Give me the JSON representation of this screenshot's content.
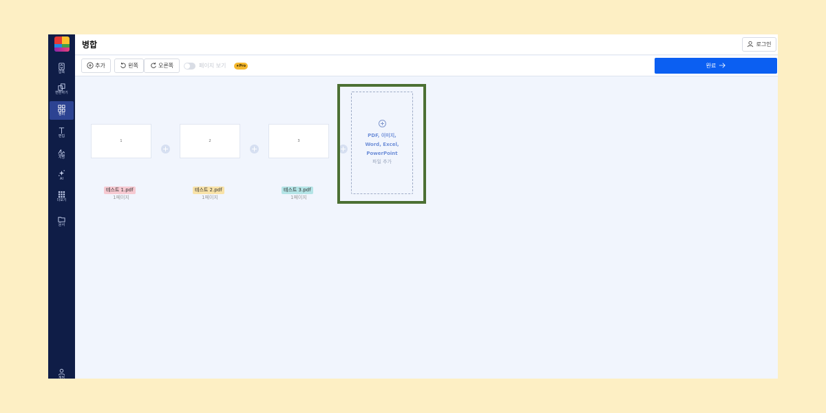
{
  "app": {
    "title": "병합"
  },
  "header": {
    "login_label": "로그인"
  },
  "sidebar": {
    "items": [
      {
        "label": "압축",
        "icon": "compress-icon",
        "active": false
      },
      {
        "label": "변환하기",
        "icon": "convert-icon",
        "active": false
      },
      {
        "label": "정리",
        "icon": "organize-icon",
        "active": true
      },
      {
        "label": "편집",
        "icon": "text-edit-icon",
        "active": false
      },
      {
        "label": "서명",
        "icon": "signature-icon",
        "active": false
      },
      {
        "label": "AI",
        "icon": "sparkle-icon",
        "active": false
      },
      {
        "label": "더보기",
        "icon": "grid-more-icon",
        "active": false
      },
      {
        "label": "문서",
        "icon": "folder-icon",
        "active": false
      }
    ],
    "account_label": "계정"
  },
  "toolbar": {
    "add_label": "추가",
    "rotate_left_label": "왼쪽",
    "rotate_right_label": "오른쪽",
    "page_view_label": "페이지 보기",
    "pro_badge": "★Pro",
    "done_label": "완료"
  },
  "files": [
    {
      "thumb_number": "1",
      "name": "테스트 1.pdf",
      "pages": "1페이지",
      "tag_color": "#f6c9d1"
    },
    {
      "thumb_number": "2",
      "name": "테스트 2.pdf",
      "pages": "1페이지",
      "tag_color": "#f8e2a8"
    },
    {
      "thumb_number": "3",
      "name": "테스트 3.pdf",
      "pages": "1페이지",
      "tag_color": "#b4e4e6"
    }
  ],
  "dropzone": {
    "line1": "PDF, 이미지,",
    "line2": "Word, Excel,",
    "line3": "PowerPoint",
    "sub": "파일 추가"
  },
  "colors": {
    "sidebar_bg": "#0f1d47",
    "primary": "#0b5ff2",
    "highlight": "#4c7033"
  }
}
